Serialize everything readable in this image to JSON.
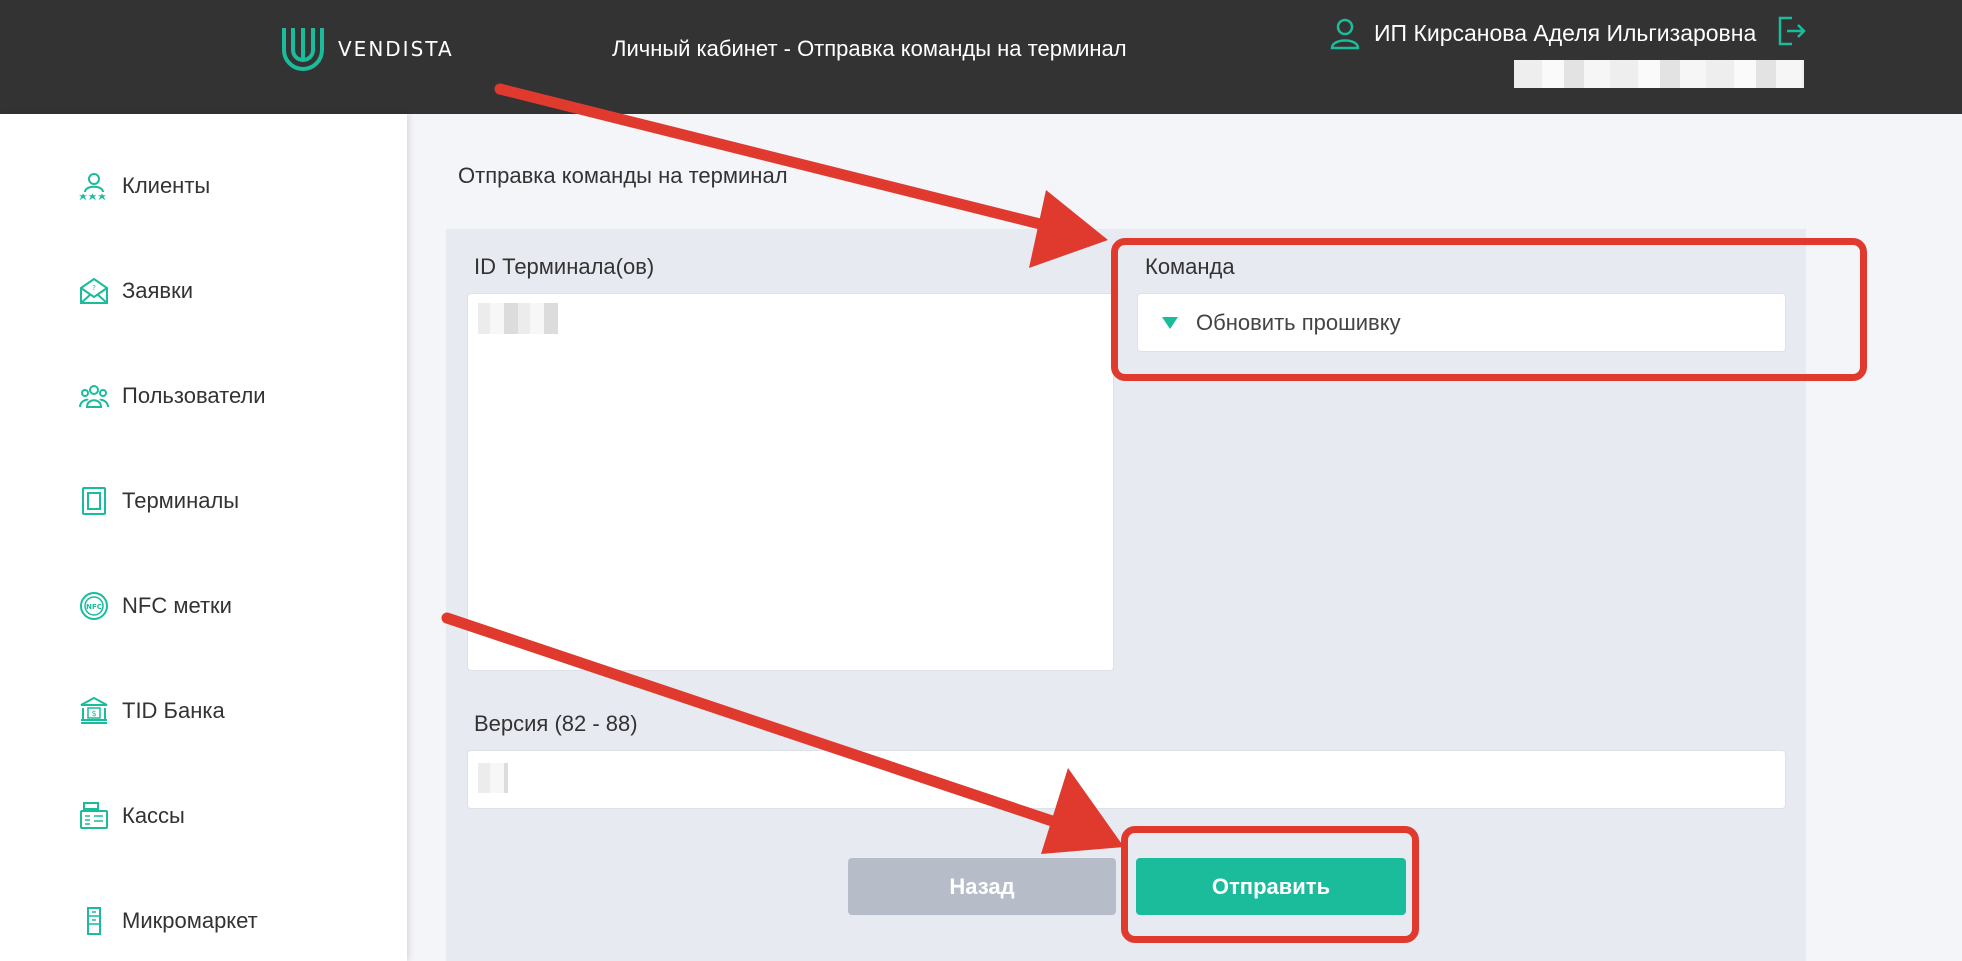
{
  "header": {
    "logo_text": "VENDISTA",
    "title": "Личный кабинет - Отправка команды на терминал",
    "user_name": "ИП Кирсанова Аделя Ильгизаровна"
  },
  "sidebar": {
    "items": [
      {
        "label": "Клиенты",
        "icon": "clients-icon"
      },
      {
        "label": "Заявки",
        "icon": "envelope-icon"
      },
      {
        "label": "Пользователи",
        "icon": "users-icon"
      },
      {
        "label": "Терминалы",
        "icon": "terminal-icon"
      },
      {
        "label": "NFC метки",
        "icon": "nfc-icon"
      },
      {
        "label": "TID Банка",
        "icon": "bank-icon"
      },
      {
        "label": "Кассы",
        "icon": "cash-register-icon"
      },
      {
        "label": "Микромаркет",
        "icon": "micromarket-icon"
      }
    ]
  },
  "main": {
    "heading": "Отправка команды на терминал",
    "terminal_ids_label": "ID Терминала(ов)",
    "command_label": "Команда",
    "command_value": "Обновить прошивку",
    "version_label": "Версия (82 - 88)",
    "back_button": "Назад",
    "send_button": "Отправить"
  },
  "colors": {
    "header_bg": "#333333",
    "accent": "#1abc9c",
    "annotation": "#e03a2f",
    "back_button_bg": "#b7bcc9"
  }
}
